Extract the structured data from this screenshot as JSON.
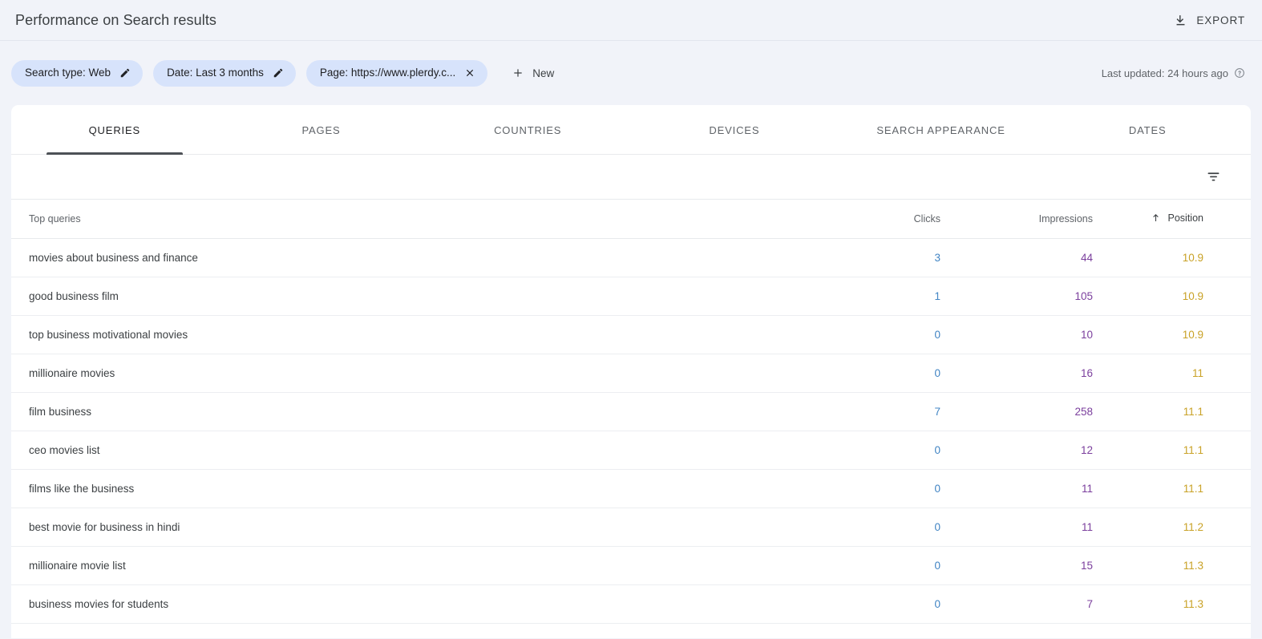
{
  "header": {
    "title": "Performance on Search results",
    "export_label": "EXPORT",
    "export_icon": "download-icon"
  },
  "filters": {
    "chips": [
      {
        "label": "Search type: Web",
        "action_icon": "pencil-icon"
      },
      {
        "label": "Date: Last 3 months",
        "action_icon": "pencil-icon"
      },
      {
        "label": "Page: https://www.plerdy.c...",
        "action_icon": "close-icon"
      }
    ],
    "new_label": "New",
    "new_icon": "plus-icon",
    "last_updated": "Last updated: 24 hours ago",
    "help_icon": "help-circle-icon"
  },
  "tabs": [
    {
      "label": "QUERIES",
      "active": true
    },
    {
      "label": "PAGES",
      "active": false
    },
    {
      "label": "COUNTRIES",
      "active": false
    },
    {
      "label": "DEVICES",
      "active": false
    },
    {
      "label": "SEARCH APPEARANCE",
      "active": false
    },
    {
      "label": "DATES",
      "active": false
    }
  ],
  "toolbar": {
    "filter_icon": "funnel-icon"
  },
  "table": {
    "columns": {
      "query": "Top queries",
      "clicks": "Clicks",
      "impressions": "Impressions",
      "position": "Position"
    },
    "sort": {
      "column": "Position",
      "direction": "asc",
      "icon": "arrow-up-icon"
    },
    "rows": [
      {
        "query": "movies about business and finance",
        "clicks": "3",
        "impressions": "44",
        "position": "10.9"
      },
      {
        "query": "good business film",
        "clicks": "1",
        "impressions": "105",
        "position": "10.9"
      },
      {
        "query": "top business motivational movies",
        "clicks": "0",
        "impressions": "10",
        "position": "10.9"
      },
      {
        "query": "millionaire movies",
        "clicks": "0",
        "impressions": "16",
        "position": "11"
      },
      {
        "query": "film business",
        "clicks": "7",
        "impressions": "258",
        "position": "11.1"
      },
      {
        "query": "ceo movies list",
        "clicks": "0",
        "impressions": "12",
        "position": "11.1"
      },
      {
        "query": "films like the business",
        "clicks": "0",
        "impressions": "11",
        "position": "11.1"
      },
      {
        "query": "best movie for business in hindi",
        "clicks": "0",
        "impressions": "11",
        "position": "11.2"
      },
      {
        "query": "millionaire movie list",
        "clicks": "0",
        "impressions": "15",
        "position": "11.3"
      },
      {
        "query": "business movies for students",
        "clicks": "0",
        "impressions": "7",
        "position": "11.3"
      }
    ]
  },
  "colors": {
    "page_background": "#f1f3f9",
    "card_background": "#ffffff",
    "chip_background": "#d7e3fb",
    "clicks_value": "#4285c4",
    "impressions_value": "#7b3f9d",
    "position_value": "#c9a227",
    "active_tab_indicator": "#4d5156"
  }
}
